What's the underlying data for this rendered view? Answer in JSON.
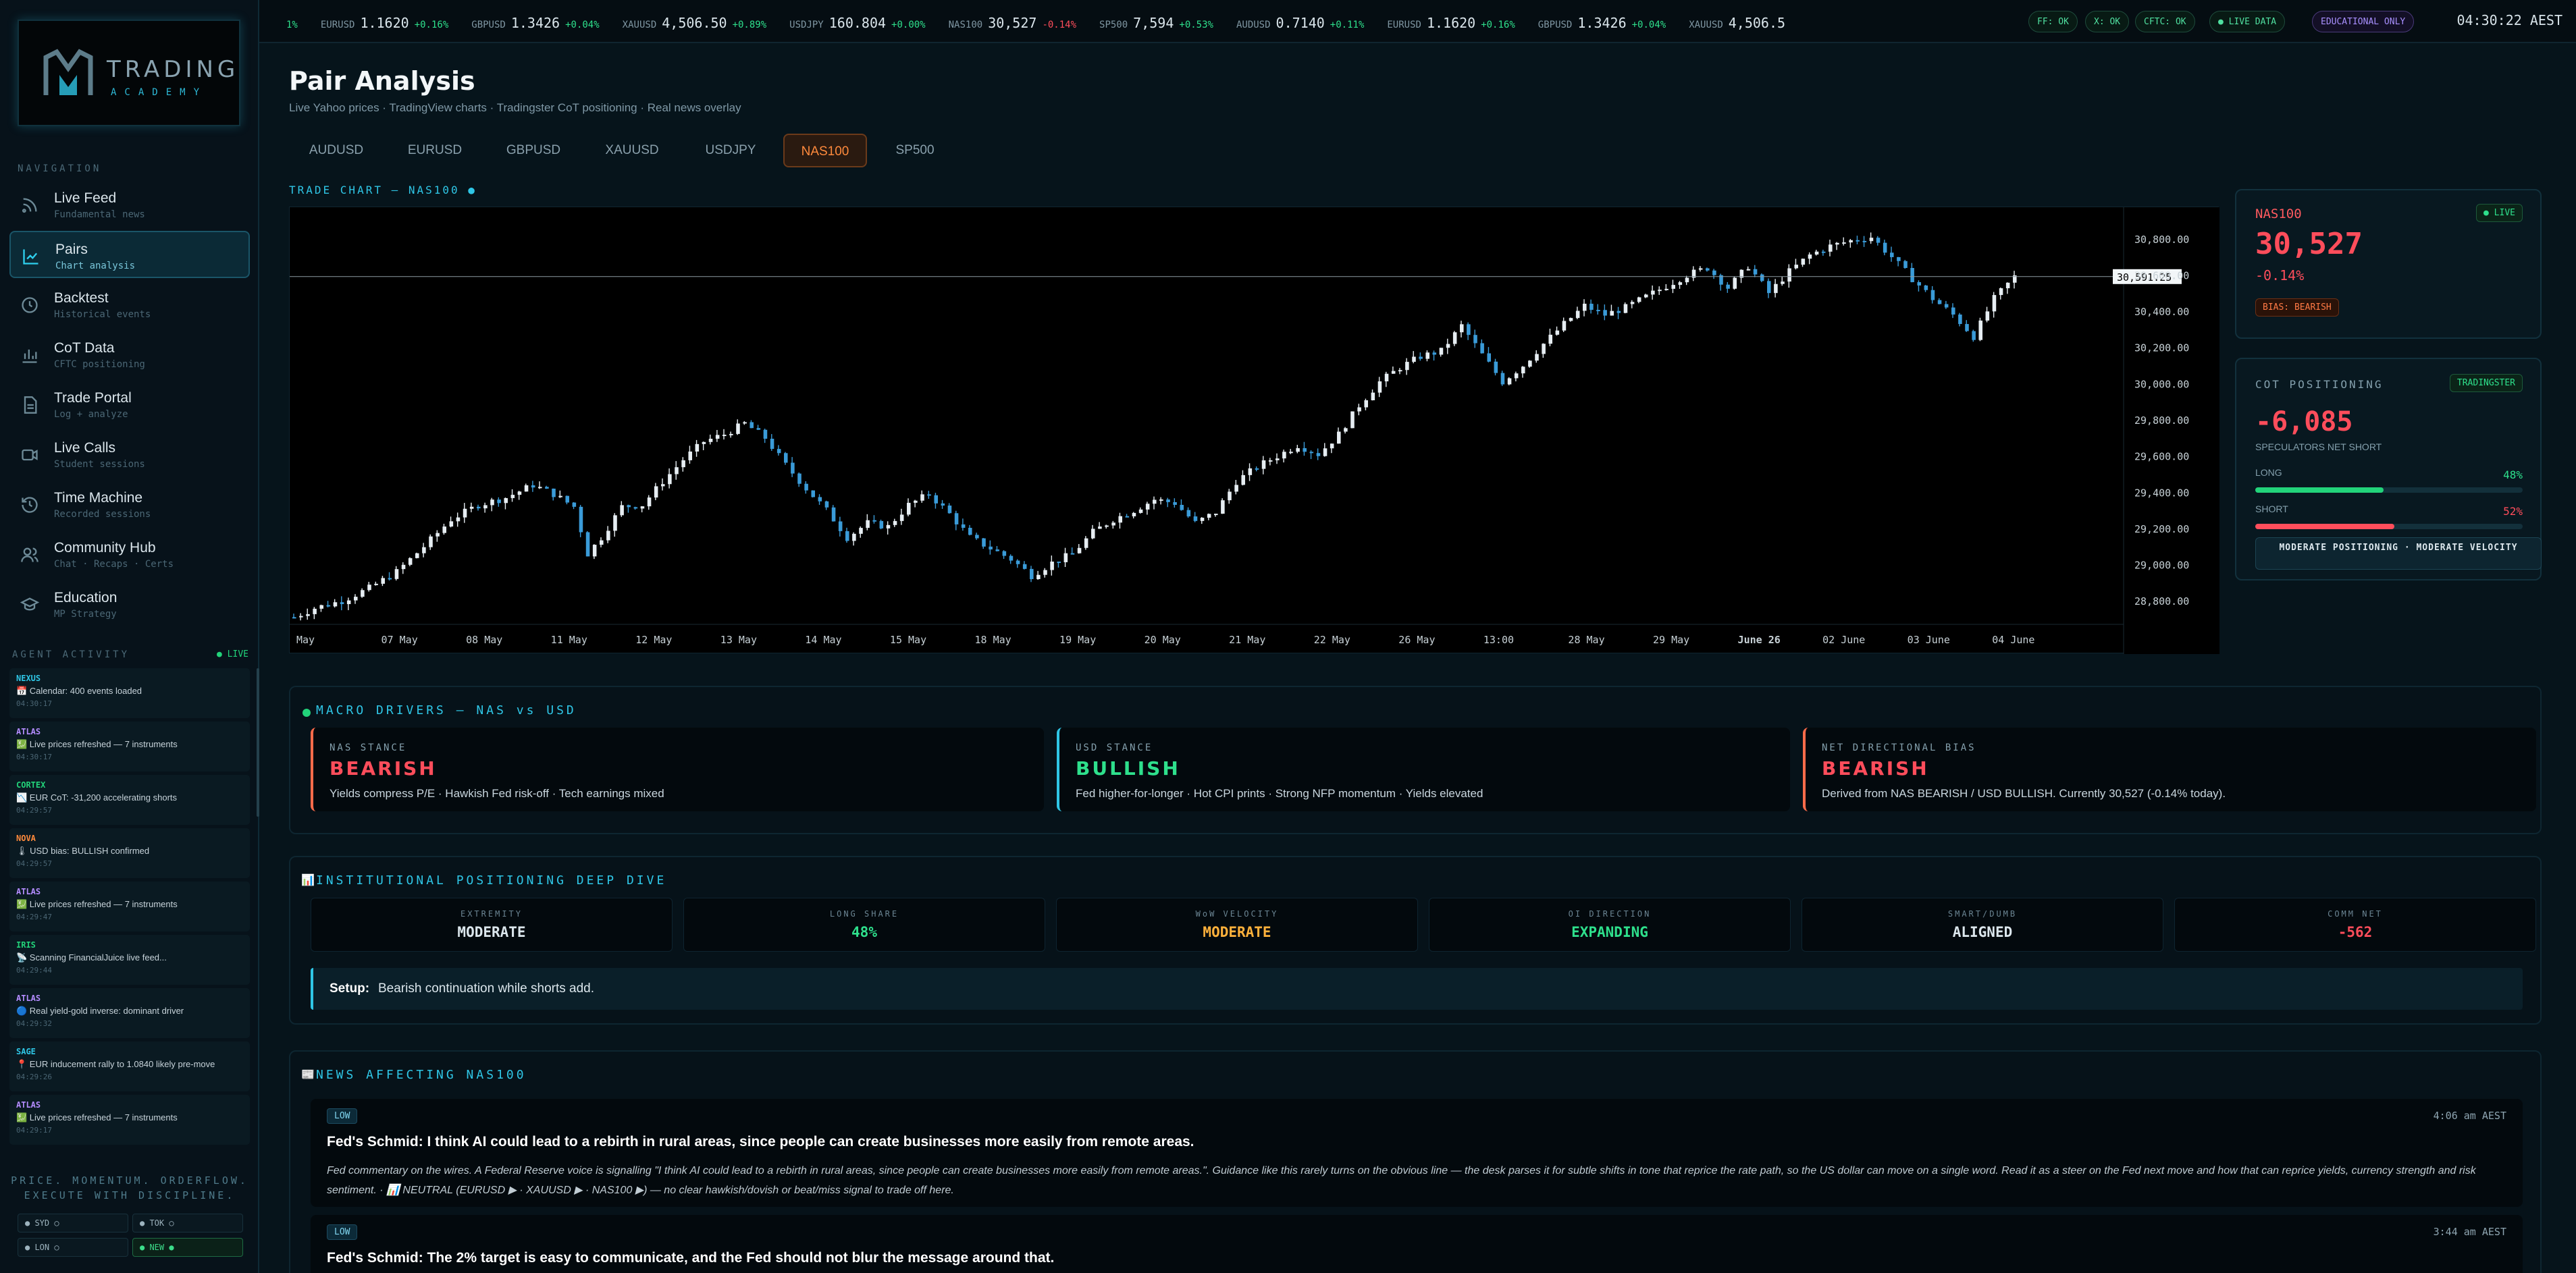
{
  "sidebar": {
    "logo": {
      "brand": "TRADING",
      "sub": "ACADEMY"
    },
    "nav_heading": "NAVIGATION",
    "items": [
      {
        "title": "Live Feed",
        "sub": "Fundamental news",
        "icon": "rss-icon"
      },
      {
        "title": "Pairs",
        "sub": "Chart analysis",
        "icon": "line-chart-icon"
      },
      {
        "title": "Backtest",
        "sub": "Historical events",
        "icon": "clock-icon"
      },
      {
        "title": "CoT Data",
        "sub": "CFTC positioning",
        "icon": "bar-chart-icon"
      },
      {
        "title": "Trade Portal",
        "sub": "Log + analyze",
        "icon": "document-icon"
      },
      {
        "title": "Live Calls",
        "sub": "Student sessions",
        "icon": "video-icon"
      },
      {
        "title": "Time Machine",
        "sub": "Recorded sessions",
        "icon": "history-icon"
      },
      {
        "title": "Community Hub",
        "sub": "Chat · Recaps · Certs",
        "icon": "users-icon"
      },
      {
        "title": "Education",
        "sub": "MP Strategy",
        "icon": "graduation-cap-icon"
      }
    ],
    "agent_heading": "AGENT ACTIVITY",
    "agent_live": "● LIVE",
    "agents": [
      {
        "name": "NEXUS",
        "color": "#2fc6e6",
        "msg": "📅 Calendar: 400 events loaded",
        "time": "04:30:17"
      },
      {
        "name": "ATLAS",
        "color": "#b48cff",
        "msg": "💹 Live prices refreshed — 7 instruments",
        "time": "04:30:17"
      },
      {
        "name": "CORTEX",
        "color": "#22d37a",
        "msg": "📉 EUR CoT: -31,200 accelerating shorts",
        "time": "04:29:57"
      },
      {
        "name": "NOVA",
        "color": "#ff8a3c",
        "msg": "🌡 USD bias: BULLISH confirmed",
        "time": "04:29:57"
      },
      {
        "name": "ATLAS",
        "color": "#b48cff",
        "msg": "💹 Live prices refreshed — 7 instruments",
        "time": "04:29:47"
      },
      {
        "name": "IRIS",
        "color": "#22d37a",
        "msg": "📡 Scanning FinancialJuice live feed...",
        "time": "04:29:44"
      },
      {
        "name": "ATLAS",
        "color": "#b48cff",
        "msg": "🔵 Real yield-gold inverse: dominant driver",
        "time": "04:29:32"
      },
      {
        "name": "SAGE",
        "color": "#2fc6e6",
        "msg": "📍 EUR inducement rally to 1.0840 likely pre-move",
        "time": "04:29:26"
      },
      {
        "name": "ATLAS",
        "color": "#b48cff",
        "msg": "💹 Live prices refreshed — 7 instruments",
        "time": "04:29:17"
      }
    ],
    "tagline1": "PRICE. MOMENTUM. ORDERFLOW.",
    "tagline2": "EXECUTE WITH DISCIPLINE.",
    "markets": [
      {
        "label": "● SYD ○",
        "on": false
      },
      {
        "label": "● TOK ○",
        "on": false
      },
      {
        "label": "● LON ○",
        "on": false
      },
      {
        "label": "● NEW ●",
        "on": true
      }
    ]
  },
  "ticker": {
    "lead": "1%",
    "items": [
      {
        "sym": "EURUSD",
        "price": "1.1620",
        "chg": "+0.16%",
        "dir": "up"
      },
      {
        "sym": "GBPUSD",
        "price": "1.3426",
        "chg": "+0.04%",
        "dir": "up"
      },
      {
        "sym": "XAUUSD",
        "price": "4,506.50",
        "chg": "+0.89%",
        "dir": "up"
      },
      {
        "sym": "USDJPY",
        "price": "160.804",
        "chg": "+0.00%",
        "dir": "up"
      },
      {
        "sym": "NAS100",
        "price": "30,527",
        "chg": "-0.14%",
        "dir": "dn"
      },
      {
        "sym": "SP500",
        "price": "7,594",
        "chg": "+0.53%",
        "dir": "up"
      },
      {
        "sym": "AUDUSD",
        "price": "0.7140",
        "chg": "+0.11%",
        "dir": "up"
      },
      {
        "sym": "EURUSD",
        "price": "1.1620",
        "chg": "+0.16%",
        "dir": "up"
      },
      {
        "sym": "GBPUSD",
        "price": "1.3426",
        "chg": "+0.04%",
        "dir": "up"
      },
      {
        "sym": "XAUUSD",
        "price": "4,506.5",
        "chg": "",
        "dir": "up"
      }
    ],
    "status": [
      "FF: OK",
      "X: OK",
      "CFTC: OK"
    ],
    "live": "● LIVE DATA",
    "edu": "EDUCATIONAL ONLY",
    "clock": "04:30:22 AEST"
  },
  "page": {
    "title": "Pair Analysis",
    "subtitle": "Live Yahoo prices · TradingView charts · Tradingster CoT positioning · Real news overlay",
    "tabs": [
      "AUDUSD",
      "EURUSD",
      "GBPUSD",
      "XAUUSD",
      "USDJPY",
      "NAS100",
      "SP500"
    ],
    "active_tab": "NAS100",
    "chart_label": "TRADE CHART — NAS100 ●"
  },
  "chart_data": {
    "type": "candlestick",
    "title": "",
    "ylim": [
      28700,
      30900
    ],
    "y_ticks": [
      "30,800.00",
      "30,600.00",
      "30,400.00",
      "30,200.00",
      "30,000.00",
      "29,800.00",
      "29,600.00",
      "29,400.00",
      "29,200.00",
      "29,000.00",
      "28,800.00"
    ],
    "x_ticks": [
      "May",
      "07 May",
      "08 May",
      "11 May",
      "12 May",
      "13 May",
      "14 May",
      "15 May",
      "18 May",
      "19 May",
      "20 May",
      "21 May",
      "22 May",
      "26 May",
      "13:00",
      "28 May",
      "29 May",
      "June 26",
      "02 June",
      "03 June",
      "04 June"
    ],
    "last_price_label": "30,591.25",
    "last_price": 30591.25,
    "close_path": [
      [
        0,
        28710
      ],
      [
        3,
        28760
      ],
      [
        7,
        28800
      ],
      [
        11,
        28870
      ],
      [
        15,
        28960
      ],
      [
        19,
        29100
      ],
      [
        23,
        29250
      ],
      [
        27,
        29330
      ],
      [
        31,
        29370
      ],
      [
        35,
        29440
      ],
      [
        38,
        29390
      ],
      [
        41,
        29320
      ],
      [
        43,
        29060
      ],
      [
        45,
        29150
      ],
      [
        48,
        29320
      ],
      [
        51,
        29330
      ],
      [
        54,
        29460
      ],
      [
        57,
        29580
      ],
      [
        60,
        29680
      ],
      [
        63,
        29720
      ],
      [
        66,
        29780
      ],
      [
        69,
        29700
      ],
      [
        72,
        29550
      ],
      [
        75,
        29420
      ],
      [
        78,
        29300
      ],
      [
        81,
        29150
      ],
      [
        84,
        29230
      ],
      [
        87,
        29210
      ],
      [
        90,
        29330
      ],
      [
        93,
        29390
      ],
      [
        96,
        29280
      ],
      [
        99,
        29150
      ],
      [
        102,
        29090
      ],
      [
        105,
        29030
      ],
      [
        108,
        28940
      ],
      [
        111,
        29010
      ],
      [
        114,
        29060
      ],
      [
        117,
        29180
      ],
      [
        120,
        29250
      ],
      [
        123,
        29300
      ],
      [
        126,
        29360
      ],
      [
        129,
        29340
      ],
      [
        132,
        29230
      ],
      [
        135,
        29290
      ],
      [
        138,
        29460
      ],
      [
        141,
        29540
      ],
      [
        144,
        29600
      ],
      [
        147,
        29660
      ],
      [
        150,
        29610
      ],
      [
        153,
        29720
      ],
      [
        156,
        29880
      ],
      [
        159,
        30010
      ],
      [
        162,
        30090
      ],
      [
        165,
        30150
      ],
      [
        168,
        30180
      ],
      [
        171,
        30320
      ],
      [
        174,
        30160
      ],
      [
        177,
        30010
      ],
      [
        180,
        30100
      ],
      [
        183,
        30220
      ],
      [
        186,
        30330
      ],
      [
        189,
        30430
      ],
      [
        192,
        30380
      ],
      [
        195,
        30420
      ],
      [
        198,
        30480
      ],
      [
        201,
        30540
      ],
      [
        204,
        30600
      ],
      [
        207,
        30640
      ],
      [
        210,
        30530
      ],
      [
        213,
        30650
      ],
      [
        216,
        30500
      ],
      [
        219,
        30620
      ],
      [
        222,
        30710
      ],
      [
        225,
        30760
      ],
      [
        228,
        30790
      ],
      [
        231,
        30810
      ],
      [
        234,
        30700
      ],
      [
        237,
        30580
      ],
      [
        240,
        30470
      ],
      [
        243,
        30380
      ],
      [
        246,
        30260
      ],
      [
        249,
        30470
      ],
      [
        252,
        30591
      ]
    ]
  },
  "price_card": {
    "symbol": "NAS100",
    "live": "● LIVE",
    "price": "30,527",
    "change": "-0.14%",
    "bias": "BIAS: BEARISH"
  },
  "cot": {
    "heading": "COT POSITIONING",
    "source": "TRADINGSTER",
    "net": "-6,085",
    "net_label": "SPECULATORS NET SHORT",
    "long_label": "LONG",
    "long_pct": "48%",
    "long_value": 0.48,
    "short_label": "SHORT",
    "short_pct": "52%",
    "short_value": 0.52,
    "summary": "MODERATE POSITIONING · MODERATE VELOCITY"
  },
  "macro": {
    "title": "MACRO DRIVERS — NAS vs USD",
    "cards": [
      {
        "head": "NAS STANCE",
        "value": "BEARISH",
        "color": "#ff4d5b",
        "border": "#ff6b4a",
        "desc": "Yields compress P/E · Hawkish Fed risk-off · Tech earnings mixed"
      },
      {
        "head": "USD STANCE",
        "value": "BULLISH",
        "color": "#2ee08c",
        "border": "#2fc6e6",
        "desc": "Fed higher-for-longer · Hot CPI prints · Strong NFP momentum · Yields elevated"
      },
      {
        "head": "NET DIRECTIONAL BIAS",
        "value": "BEARISH",
        "color": "#ff4d5b",
        "border": "#ff6b4a",
        "desc": "Derived from NAS BEARISH / USD BULLISH. Currently 30,527 (-0.14% today)."
      }
    ]
  },
  "institutional": {
    "title": "INSTITUTIONAL POSITIONING DEEP DIVE",
    "metrics": [
      {
        "head": "EXTREMITY",
        "value": "MODERATE",
        "color": "#dbe6ec"
      },
      {
        "head": "LONG SHARE",
        "value": "48%",
        "color": "#2ee08c"
      },
      {
        "head": "WoW VELOCITY",
        "value": "MODERATE",
        "color": "#ffb13b"
      },
      {
        "head": "OI DIRECTION",
        "value": "EXPANDING",
        "color": "#2ee08c"
      },
      {
        "head": "SMART/DUMB",
        "value": "ALIGNED",
        "color": "#dbe6ec"
      },
      {
        "head": "COMM NET",
        "value": "-562",
        "color": "#ff4d5b"
      }
    ],
    "setup_label": "Setup:",
    "setup_text": "Bearish continuation while shorts add."
  },
  "news": {
    "title": "NEWS AFFECTING NAS100",
    "items": [
      {
        "level": "LOW",
        "time": "4:06 am AEST",
        "headline": "Fed's Schmid: I think AI could lead to a rebirth in rural areas, since people can create businesses more easily from remote areas.",
        "body": "Fed commentary on the wires. A Federal Reserve voice is signalling \"I think AI could lead to a rebirth in rural areas, since people can create businesses more easily from remote areas.\". Guidance like this rarely turns on the obvious line — the desk parses it for subtle shifts in tone that reprice the rate path, so the US dollar can move on a single word. Read it as a steer on the Fed next move and how that can reprice yields, currency strength and risk sentiment. · 📊 NEUTRAL (EURUSD ▶ · XAUUSD ▶ · NAS100 ▶) — no clear hawkish/dovish or beat/miss signal to trade off here."
      },
      {
        "level": "LOW",
        "time": "3:44 am AEST",
        "headline": "Fed's Schmid: The 2% target is easy to communicate, and the Fed should not blur the message around that.",
        "body": ""
      }
    ]
  }
}
